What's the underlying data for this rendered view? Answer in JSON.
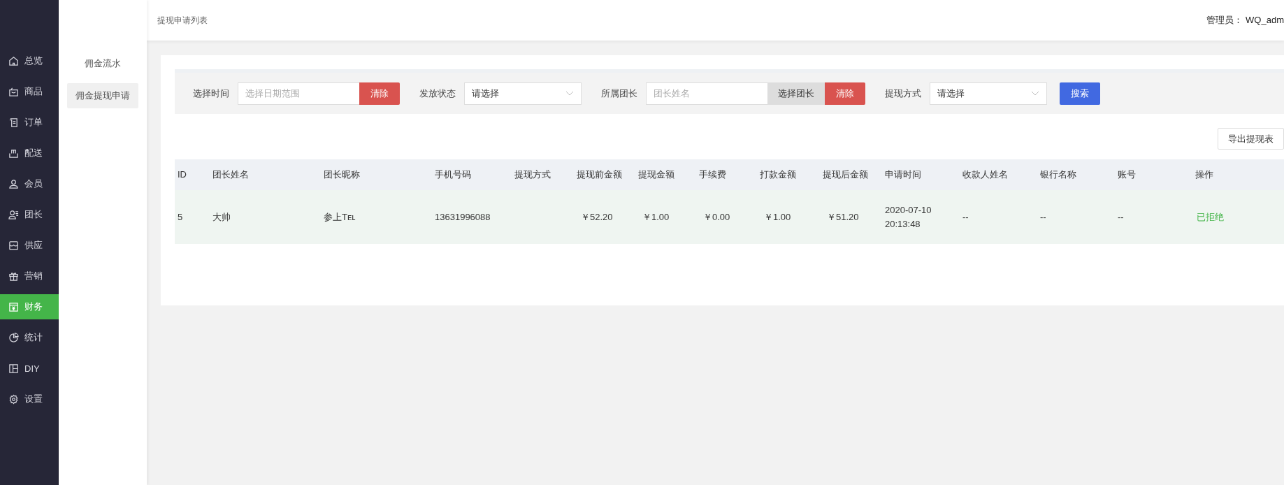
{
  "sidebar": {
    "items": [
      {
        "label": "总览",
        "selected": false
      },
      {
        "label": "商品",
        "selected": false
      },
      {
        "label": "订单",
        "selected": false
      },
      {
        "label": "配送",
        "selected": false
      },
      {
        "label": "会员",
        "selected": false
      },
      {
        "label": "团长",
        "selected": false
      },
      {
        "label": "供应",
        "selected": false
      },
      {
        "label": "营销",
        "selected": false
      },
      {
        "label": "财务",
        "selected": true
      },
      {
        "label": "统计",
        "selected": false
      },
      {
        "label": "DIY",
        "selected": false
      },
      {
        "label": "设置",
        "selected": false
      }
    ]
  },
  "subnav": {
    "items": [
      {
        "label": "佣金流水",
        "selected": false
      },
      {
        "label": "佣金提现申请",
        "selected": true
      }
    ]
  },
  "header": {
    "title": "提现申请列表",
    "admin": "管理员： WQ_adm"
  },
  "filters": [
    {
      "kind": "date",
      "label": "选择时间",
      "placeholder": "选择日期范围",
      "clear": "清除"
    },
    {
      "kind": "select",
      "label": "发放状态",
      "value": "请选择"
    },
    {
      "kind": "picker",
      "label": "所属团长",
      "placeholder": "团长姓名",
      "pick": "选择团长",
      "clear": "清除"
    },
    {
      "kind": "select",
      "label": "提现方式",
      "value": "请选择"
    }
  ],
  "search_button": "搜索",
  "export_button": "导出提现表",
  "table": {
    "columns": [
      "ID",
      "团长姓名",
      "团长昵称",
      "手机号码",
      "提现方式",
      "提现前金额",
      "提现金额",
      "手续费",
      "打款金额",
      "提现后金额",
      "申请时间",
      "收款人姓名",
      "银行名称",
      "账号",
      "操作"
    ],
    "rows": [
      {
        "cells": [
          "5",
          "大帅",
          "参上Tᴇʟ",
          "13631996088",
          "",
          "￥52.20",
          "￥1.00",
          "￥0.00",
          "￥1.00",
          "￥51.20",
          "2020-07-10 20:13:48",
          "--",
          "--",
          "--"
        ],
        "status": "已拒绝"
      }
    ]
  }
}
